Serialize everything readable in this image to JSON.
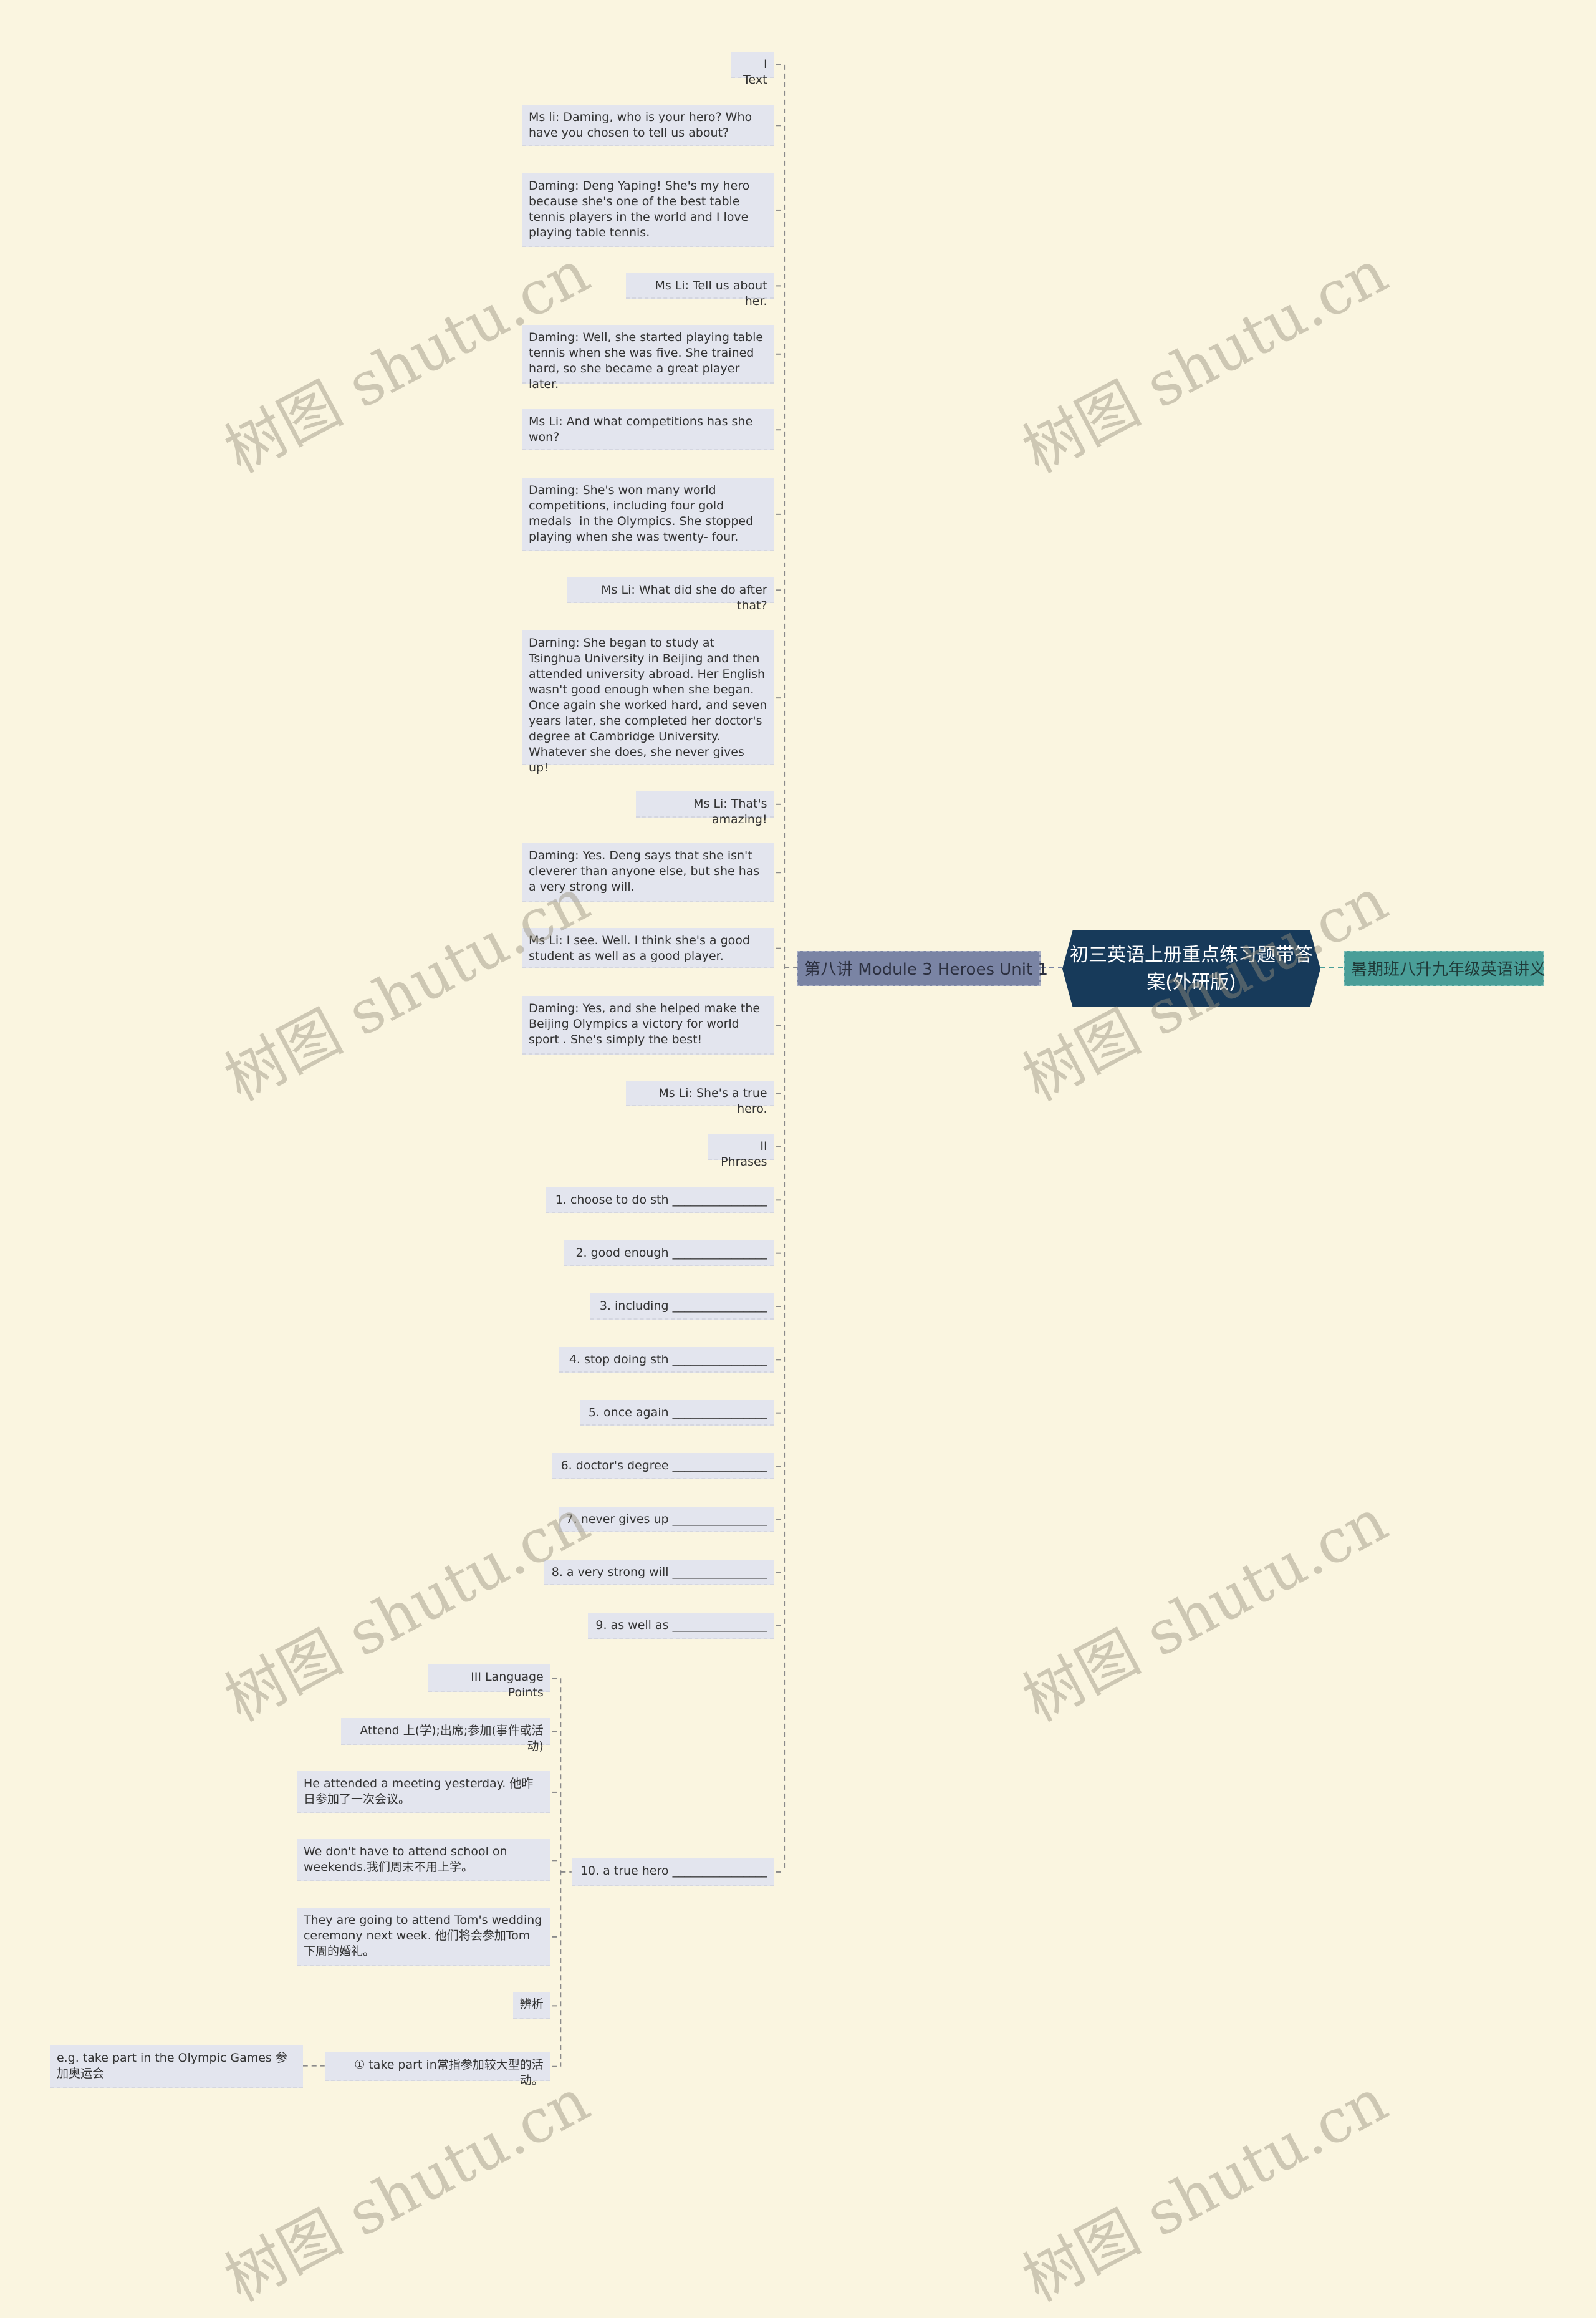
{
  "center": {
    "title": "初三英语上册重点练习题带答案(外研版)"
  },
  "branch": {
    "label": "第八讲 Module 3 Heroes Unit 1"
  },
  "right": {
    "label": "暑期班八升九年级英语讲义"
  },
  "items": [
    "I Text",
    "Ms li: Daming, who is your hero? Who have you chosen to tell us about?",
    "Daming: Deng Yaping! She's my hero because she's one of the best table tennis players in the world and I love playing table tennis.",
    "Ms Li: Tell us about her.",
    "Daming: Well, she started playing table tennis when she was five. She trained hard, so she became a great player later.",
    "Ms Li: And what competitions has she won?",
    "Daming: She's won many world competitions, including four gold medals  in the Olympics. She stopped playing when she was twenty- four.",
    "Ms Li: What did she do after that?",
    "Darning: She began to study at Tsinghua University in Beijing and then attended university abroad. Her English wasn't good enough when she began. Once again she worked hard, and seven years later, she completed her doctor's degree at Cambridge University. Whatever she does, she never gives up!",
    "Ms Li: That's amazing!",
    "Daming: Yes. Deng says that she isn't cleverer than anyone else, but she has a very strong will.",
    "Ms Li: I see. Well. I think she's a good student as well as a good player.",
    "Daming: Yes, and she helped make the Beijing Olympics a victory for world sport . She's simply the best!",
    "Ms Li: She's a true hero.",
    "II Phrases",
    "1. choose to do sth ________________",
    "2. good enough ________________",
    "3. including ________________",
    "4. stop doing sth ________________",
    "5. once again ________________",
    "6. doctor's degree ________________",
    "7. never gives up ________________",
    "8. a very strong will ________________",
    "9. as well as ________________",
    "10. a true hero ________________"
  ],
  "sub_items": [
    "III Language Points",
    "Attend 上(学);出席;参加(事件或活动)",
    "He attended a meeting yesterday. 他昨日参加了一次会议。",
    "We don't have to attend school on weekends.我们周末不用上学。",
    "They are going to attend Tom's wedding ceremony next week. 他们将会参加Tom 下周的婚礼。",
    "辨析",
    "① take part in常指参加较大型的活动。"
  ],
  "leaf": "e.g. take part in the Olympic Games 参加奥运会",
  "watermark": "树图 shutu.cn",
  "colors": {
    "background": "#faf5e0",
    "center": "#173a5a",
    "branch": "#7a84a4",
    "right": "#4a9e98",
    "node": "#e3e5ee"
  }
}
